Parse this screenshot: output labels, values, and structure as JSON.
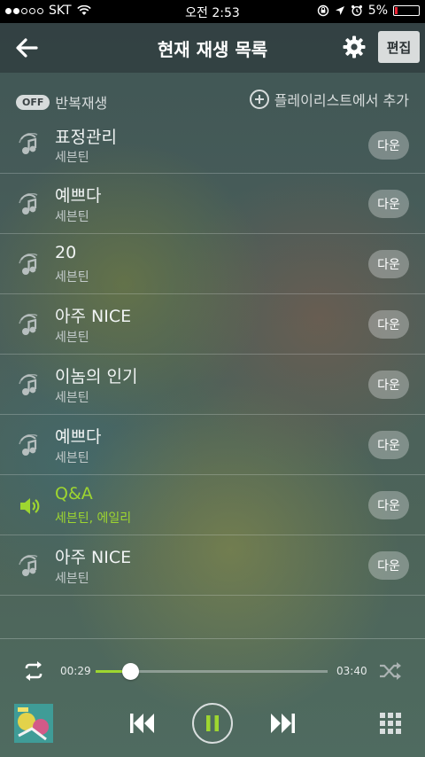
{
  "status_bar": {
    "carrier": "SKT",
    "time": "오전 2:53",
    "battery": "5%"
  },
  "header": {
    "title": "현재 재생 목록",
    "edit_label": "편집"
  },
  "subbar": {
    "repeat_state": "OFF",
    "repeat_label": "반복재생",
    "add_label": "플레이리스트에서 추가"
  },
  "playlist": [
    {
      "title": "표정관리",
      "artist": "세븐틴",
      "action": "다운"
    },
    {
      "title": "예쁘다",
      "artist": "세븐틴",
      "action": "다운"
    },
    {
      "title": "20",
      "artist": "세븐틴",
      "action": "다운"
    },
    {
      "title": "아주 NICE",
      "artist": "세븐틴",
      "action": "다운"
    },
    {
      "title": "이놈의 인기",
      "artist": "세븐틴",
      "action": "다운"
    },
    {
      "title": "예쁘다",
      "artist": "세븐틴",
      "action": "다운"
    },
    {
      "title": "Q&A",
      "artist": "세븐틴, 에일리",
      "action": "다운",
      "playing": true
    },
    {
      "title": "아주 NICE",
      "artist": "세븐틴",
      "action": "다운"
    }
  ],
  "player": {
    "elapsed": "00:29",
    "total": "03:40",
    "progress": 0.15
  },
  "colors": {
    "accent": "#9ed630",
    "header_bg": "#2f3b3d"
  }
}
